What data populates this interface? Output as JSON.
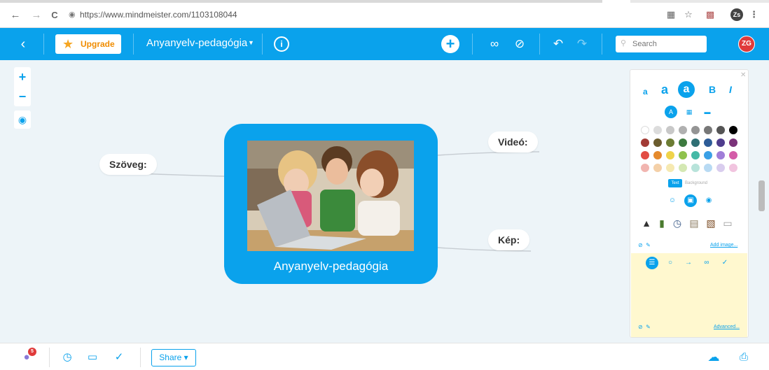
{
  "browser": {
    "url": "https://www.mindmeister.com/1103108044",
    "back_icon": "←",
    "forward_icon": "→",
    "reload_icon": "C",
    "profile_initials": "Zs"
  },
  "toolbar": {
    "upgrade_label": "Upgrade",
    "map_title": "Anyanyelv-pedagógia",
    "search_placeholder": "Search",
    "user_initials": "ZG"
  },
  "map": {
    "root_title": "Anyanyelv-pedagógia",
    "nodes": {
      "left": "Szöveg:",
      "top_right": "Videó:",
      "bottom_right": "Kép:"
    }
  },
  "panel": {
    "font_small": "a",
    "font_medium": "a",
    "font_large": "a",
    "bold": "B",
    "italic": "I",
    "text_tab": "Text",
    "background_tab": "Background",
    "add_image": "Add image...",
    "advanced": "Advanced...",
    "colors": [
      [
        "#ffffff",
        "#dcdcdc",
        "#c8c8c8",
        "#b0b0b0",
        "#949494",
        "#777777",
        "#555555",
        "#000000"
      ],
      [
        "#a23b35",
        "#6b5c2e",
        "#6c7c33",
        "#3d7a3f",
        "#2f6f74",
        "#2d5c97",
        "#4f3d8d",
        "#7a3279"
      ],
      [
        "#e24c43",
        "#e58a2c",
        "#efd34a",
        "#8fc24d",
        "#45b9a6",
        "#3aa0e6",
        "#a07ed8",
        "#d45ca8"
      ],
      [
        "#f1b5b0",
        "#f4d0a8",
        "#f6e9b1",
        "#d4e8b3",
        "#b8e3da",
        "#b8daf3",
        "#d9cdee",
        "#f1c4df"
      ]
    ]
  },
  "bottombar": {
    "notification_count": "5",
    "share_label": "Share"
  }
}
